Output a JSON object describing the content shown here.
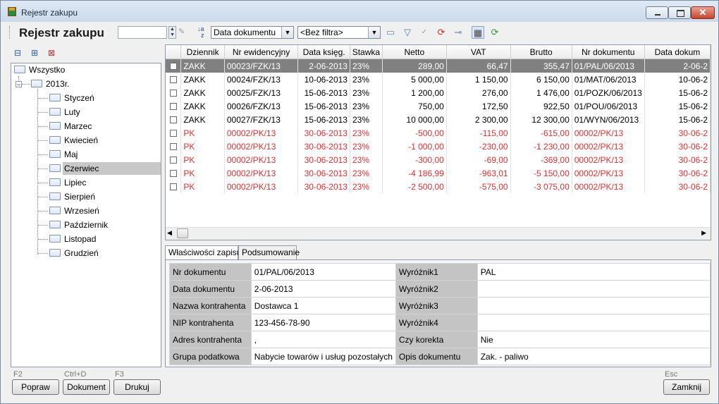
{
  "window": {
    "title": "Rejestr zakupu"
  },
  "toolbar": {
    "heading": "Rejestr zakupu",
    "search_value": "",
    "sort_field": "Data dokumentu",
    "filter": "<Bez filtra>"
  },
  "tree": {
    "root": "Wszystko",
    "year": "2013r.",
    "months": [
      "Styczeń",
      "Luty",
      "Marzec",
      "Kwiecień",
      "Maj",
      "Czerwiec",
      "Lipiec",
      "Sierpień",
      "Wrzesień",
      "Październik",
      "Listopad",
      "Grudzień"
    ],
    "selected": "Czerwiec"
  },
  "grid": {
    "columns": [
      "Dziennik",
      "Nr ewidencyjny",
      "Data księg.",
      "Stawka",
      "Netto",
      "VAT",
      "Brutto",
      "Nr dokumentu",
      "Data dokum"
    ],
    "rows": [
      [
        "ZAKK",
        "00023/FZK/13",
        "2-06-2013",
        "23%",
        "289,00",
        "66,47",
        "355,47",
        "01/PAL/06/2013",
        "2-06-2"
      ],
      [
        "ZAKK",
        "00024/FZK/13",
        "10-06-2013",
        "23%",
        "5 000,00",
        "1 150,00",
        "6 150,00",
        "01/MAT/06/2013",
        "10-06-2"
      ],
      [
        "ZAKK",
        "00025/FZK/13",
        "15-06-2013",
        "23%",
        "1 200,00",
        "276,00",
        "1 476,00",
        "01/POZK/06/2013",
        "15-06-2"
      ],
      [
        "ZAKK",
        "00026/FZK/13",
        "15-06-2013",
        "23%",
        "750,00",
        "172,50",
        "922,50",
        "01/POU/06/2013",
        "15-06-2"
      ],
      [
        "ZAKK",
        "00027/FZK/13",
        "15-06-2013",
        "23%",
        "10 000,00",
        "2 300,00",
        "12 300,00",
        "01/WYN/06/2013",
        "15-06-2"
      ],
      [
        "PK",
        "00002/PK/13",
        "30-06-2013",
        "23%",
        "-500,00",
        "-115,00",
        "-615,00",
        "00002/PK/13",
        "30-06-2"
      ],
      [
        "PK",
        "00002/PK/13",
        "30-06-2013",
        "23%",
        "-1 000,00",
        "-230,00",
        "-1 230,00",
        "00002/PK/13",
        "30-06-2"
      ],
      [
        "PK",
        "00002/PK/13",
        "30-06-2013",
        "23%",
        "-300,00",
        "-69,00",
        "-369,00",
        "00002/PK/13",
        "30-06-2"
      ],
      [
        "PK",
        "00002/PK/13",
        "30-06-2013",
        "23%",
        "-4 186,99",
        "-963,01",
        "-5 150,00",
        "00002/PK/13",
        "30-06-2"
      ],
      [
        "PK",
        "00002/PK/13",
        "30-06-2013",
        "23%",
        "-2 500,00",
        "-575,00",
        "-3 075,00",
        "00002/PK/13",
        "30-06-2"
      ]
    ]
  },
  "tabs": [
    "Właściwości zapisu",
    "Podsumowanie"
  ],
  "properties": [
    [
      "Nr dokumentu",
      "01/PAL/06/2013",
      "Wyróżnik1",
      "PAL"
    ],
    [
      "Data dokumentu",
      "2-06-2013",
      "Wyróżnik2",
      ""
    ],
    [
      "Nazwa kontrahenta",
      "Dostawca 1",
      "Wyróżnik3",
      ""
    ],
    [
      "NIP kontrahenta",
      "123-456-78-90",
      "Wyróżnik4",
      ""
    ],
    [
      "Adres kontrahenta",
      ",",
      "Czy korekta",
      "Nie"
    ],
    [
      "Grupa podatkowa",
      "Nabycie towarów i usług pozostałych",
      "Opis dokumentu",
      "Zak. - paliwo"
    ]
  ],
  "buttons": {
    "popraw": {
      "label": "Popraw",
      "key": "F2"
    },
    "dokument": {
      "label": "Dokument",
      "key": "Ctrl+D"
    },
    "drukuj": {
      "label": "Drukuj",
      "key": "F3"
    },
    "zamknij": {
      "label": "Zamknij",
      "key": "Esc"
    }
  },
  "colors": {
    "negative": "#e03030",
    "selected_row": "#808080"
  }
}
